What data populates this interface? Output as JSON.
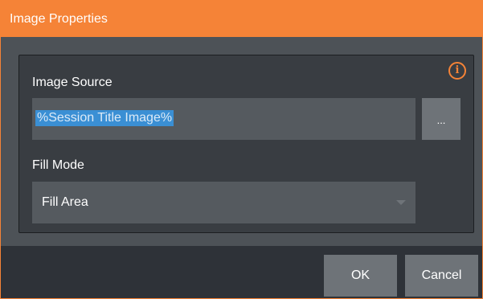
{
  "window": {
    "title": "Image Properties"
  },
  "form": {
    "info_icon_glyph": "i",
    "image_source": {
      "label": "Image Source",
      "value": "%Session Title Image%",
      "browse_label": "..."
    },
    "fill_mode": {
      "label": "Fill Mode",
      "selected": "Fill Area"
    }
  },
  "footer": {
    "ok_label": "OK",
    "cancel_label": "Cancel"
  },
  "colors": {
    "accent": "#f58337",
    "selection": "#3a8fd4",
    "panel": "#4d5257",
    "group": "#393d42",
    "footer": "#2e3238"
  }
}
